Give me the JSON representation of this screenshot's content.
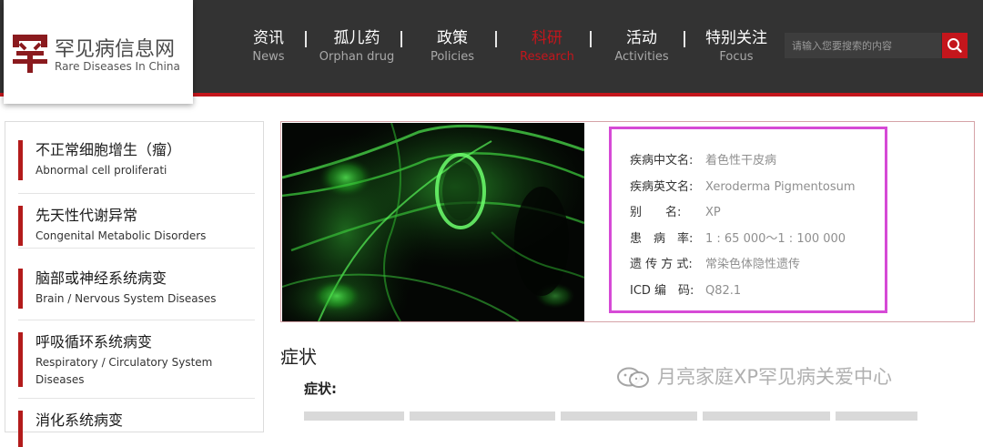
{
  "logo": {
    "cn": "罕见病信息网",
    "en": "Rare Diseases In China"
  },
  "nav": [
    {
      "cn": "资讯",
      "en": "News",
      "active": false
    },
    {
      "cn": "孤儿药",
      "en": "Orphan drug",
      "active": false
    },
    {
      "cn": "政策",
      "en": "Policies",
      "active": false
    },
    {
      "cn": "科研",
      "en": "Research",
      "active": true
    },
    {
      "cn": "活动",
      "en": "Activities",
      "active": false
    },
    {
      "cn": "特别关注",
      "en": "Focus",
      "active": false
    }
  ],
  "search": {
    "placeholder": "请输入您要搜索的内容",
    "icon": "search-icon"
  },
  "sidebar": {
    "items": [
      {
        "cn": "不正常细胞增生（瘤）",
        "en": "Abnormal cell proliferati"
      },
      {
        "cn": "先天性代谢异常",
        "en": "Congenital Metabolic Disorders"
      },
      {
        "cn": "脑部或神经系统病变",
        "en": "Brain / Nervous System Diseases"
      },
      {
        "cn": "呼吸循环系统病变",
        "en": "Respiratory / Circulatory System Diseases"
      },
      {
        "cn": "消化系统病变",
        "en": ""
      }
    ]
  },
  "disease": {
    "rows": [
      {
        "label": "疾病中文名:",
        "value": "着色性干皮病"
      },
      {
        "label": "疾病英文名:",
        "value": "Xeroderma Pigmentosum"
      },
      {
        "label": "别　　名:",
        "value": "XP"
      },
      {
        "label": "患　病　率:",
        "value": "1 : 65 000～1 : 100 000"
      },
      {
        "label": "遗 传 方 式:",
        "value": "常染色体隐性遗传"
      },
      {
        "label": "ICD 编　码:",
        "value": "Q82.1"
      }
    ]
  },
  "article": {
    "section_title": "症状",
    "sub_title": "症状:"
  },
  "watermark": {
    "text": "月亮家庭XP罕见病关爱中心",
    "icon": "wechat-icon"
  },
  "colors": {
    "header_bg": "#333333",
    "accent_red": "#c4161c",
    "highlight_magenta": "#d64ad6",
    "cell_green": "#39d639"
  }
}
